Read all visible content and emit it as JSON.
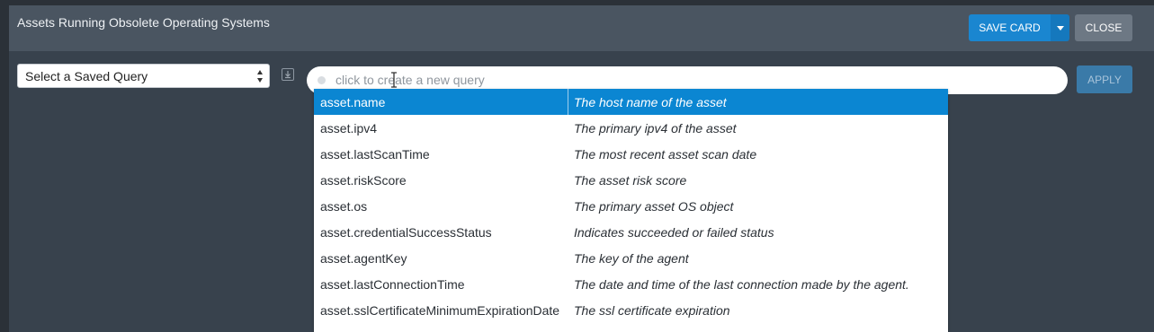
{
  "card": {
    "title": "Assets Running Obsolete Operating Systems",
    "save_label": "SAVE CARD",
    "close_label": "CLOSE"
  },
  "toolbar": {
    "saved_query_value": "Select a Saved Query",
    "query_placeholder": "click to create a new query",
    "apply_label": "APPLY"
  },
  "icons": {
    "save_menu": "chevron-down-icon",
    "select": "select-arrows-icon",
    "import": "download-icon",
    "status": "status-dot-icon",
    "cursor": "text-cursor-icon"
  },
  "colors": {
    "accent": "#0b86d2",
    "header_bg": "#4a5561",
    "card_bg": "#38424d"
  },
  "suggestions": [
    {
      "key": "asset.name",
      "desc": "The host name of the asset"
    },
    {
      "key": "asset.ipv4",
      "desc": "The primary ipv4 of the asset"
    },
    {
      "key": "asset.lastScanTime",
      "desc": "The most recent asset scan date"
    },
    {
      "key": "asset.riskScore",
      "desc": "The asset risk score"
    },
    {
      "key": "asset.os",
      "desc": "The primary asset OS object"
    },
    {
      "key": "asset.credentialSuccessStatus",
      "desc": "Indicates succeeded or failed status"
    },
    {
      "key": "asset.agentKey",
      "desc": "The key of the agent"
    },
    {
      "key": "asset.lastConnectionTime",
      "desc": "The date and time of the last connection made by the agent."
    },
    {
      "key": "asset.sslCertificateMinimumExpirationDate",
      "desc": "The ssl certificate expiration"
    }
  ]
}
